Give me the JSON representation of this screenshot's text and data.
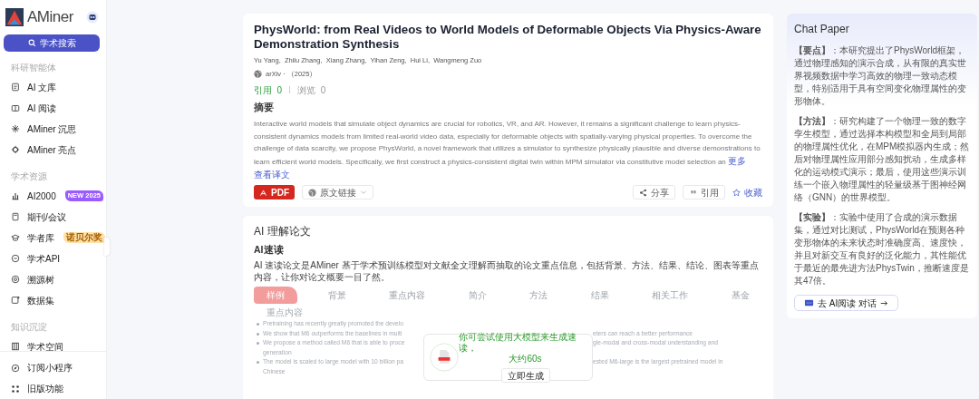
{
  "sidebar": {
    "logo": "AMiner",
    "search_button": "学术搜索",
    "sections": [
      {
        "label": "科研智能体",
        "items": [
          {
            "label": "AI 文库"
          },
          {
            "label": "AI 阅读"
          },
          {
            "label": "AMiner 沉思"
          },
          {
            "label": "AMiner 亮点"
          }
        ]
      },
      {
        "label": "学术资源",
        "items": [
          {
            "label": "AI2000",
            "badge": "NEW 2025",
            "color": "#9b5cff"
          },
          {
            "label": "期刊/会议"
          },
          {
            "label": "学者库",
            "badge": "诺贝尔奖",
            "color": "#ffe2a8"
          },
          {
            "label": "学术API"
          },
          {
            "label": "溯源树"
          },
          {
            "label": "数据集"
          }
        ]
      },
      {
        "label": "知识沉淀",
        "items": [
          {
            "label": "学术空间"
          }
        ]
      }
    ],
    "footer_items": [
      {
        "label": "订阅小程序"
      },
      {
        "label": "旧版功能"
      }
    ]
  },
  "paper": {
    "title": "PhysWorld: from Real Videos to World Models of Deformable Objects Via Physics-Aware Demonstration Synthesis",
    "authors": "Yu Yang,  Zhilu Zhang,  Xiang Zhang,  Yihan Zeng,  Hui Li,  Wangmeng Zuo",
    "venue": "arXiv · （2025）",
    "stats": [
      {
        "label": "引用",
        "value": "0",
        "highlight": true
      },
      {
        "label": "浏览",
        "value": "0",
        "highlight": false
      }
    ],
    "abstract_heading": "摘要",
    "abstract": "Interactive world models that simulate object dynamics are crucial for robotics, VR, and AR. However, it remains a significant challenge to learn physics-consistent dynamics models from limited real-world video data, especially for deformable objects with spatially-varying physical properties. To overcome the challenge of data scarcity, we propose PhysWorld, a novel framework that utilizes a simulator to synthesize physically plausible and diverse demonstrations to learn efficient world models. Specifically, we first construct a physics-consistent digital twin within MPM simulator via constitutive model selection an",
    "more_link": "更多",
    "translate_link": "查看译文",
    "actions_left": [
      {
        "label": "PDF",
        "kind": "pdf"
      },
      {
        "label": "原文链接",
        "kind": "link"
      }
    ],
    "actions_right": [
      {
        "label": "分享",
        "kind": "share"
      },
      {
        "label": "引用",
        "kind": "cite"
      },
      {
        "label": "收藏",
        "kind": "star"
      }
    ]
  },
  "ai_section": {
    "title": "AI 理解论文",
    "subtitle": "AI速读",
    "description": "AI 速读论文是AMiner 基于学术预训练模型对文献全文理解而抽取的论文重点信息，包括背景、方法、结果、结论、图表等重点内容，让你对论文概要一目了然。",
    "tabs": [
      {
        "label": "样例",
        "selected": true
      },
      {
        "label": "背景",
        "selected": false
      },
      {
        "label": "重点内容",
        "selected": false
      },
      {
        "label": "简介",
        "selected": false
      },
      {
        "label": "方法",
        "selected": false
      },
      {
        "label": "结果",
        "selected": false
      },
      {
        "label": "相关工作",
        "selected": false
      },
      {
        "label": "基金",
        "selected": false
      }
    ],
    "example_heading": "重点内容",
    "example_lines": [
      {
        "bullet": true,
        "left": "Pretraining has recently greatly promoted the develo"
      },
      {
        "bullet": true,
        "left": "We show that M6 outperforms the baselines in multi",
        "right": "eters can reach a better performance"
      },
      {
        "bullet": true,
        "left": "We propose a method called M6 that is able to proce",
        "right": "gle-modal and cross-modal understanding and"
      },
      {
        "bullet": false,
        "left": "generation"
      },
      {
        "bullet": true,
        "left": "The model is scaled to large model with 10 billion pa",
        "right": "ested M6-large is the largest pretrained model in"
      },
      {
        "bullet": false,
        "left": "Chinese"
      }
    ],
    "popup": {
      "message": [
        "你可尝试使用大模型来生成速读，",
        "大约60s"
      ],
      "button": "立即生成"
    }
  },
  "chat_paper": {
    "title": "Chat Paper",
    "paragraphs": [
      "**【要点】**：本研究提出了PhysWorld框架，通过物理感知的演示合成，从有限的真实世界视频数据中学习高效的物理一致动态模型，特别适用于具有空间变化物理属性的变形物体。",
      "**【方法】**：研究构建了一个物理一致的数字孪生模型，通过选择本构模型和全局到局部的物理属性优化，在MPM模拟器内生成；然后对物理属性应用部分感知扰动，生成多样化的运动模式演示；最后，使用这些演示训练一个嵌入物理属性的轻量级基于图神经网络（GNN）的世界模型。",
      "**【实验】**：实验中使用了合成的演示数据集，通过对比测试，PhysWorld在预测各种变形物体的未来状态时准确度高、速度快，并且对新交互有良好的泛化能力，其性能优于最近的最先进方法PhysTwin，推断速度是其47倍。"
    ],
    "button": "去 AI阅读 对话"
  }
}
